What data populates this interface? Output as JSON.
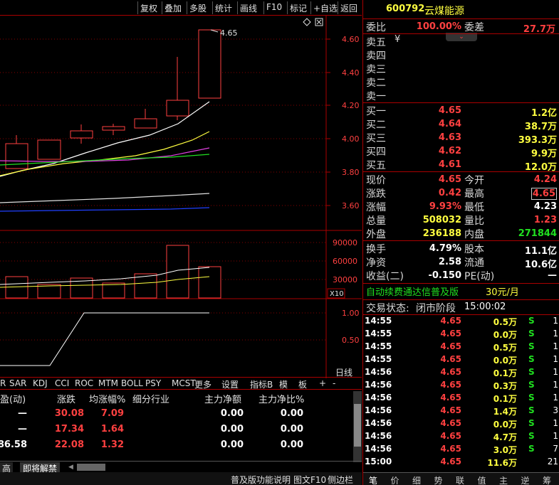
{
  "menu": [
    "复权",
    "叠加",
    "多股",
    "统计",
    "画线",
    "F10",
    "标记",
    "+自选",
    "返回"
  ],
  "stock": {
    "code": "600792",
    "name": "云煤能源"
  },
  "chart": {
    "price_ticks": [
      "4.60",
      "4.40",
      "4.20",
      "4.00",
      "3.80",
      "3.60"
    ],
    "last_label": "4.65",
    "vol_ticks": [
      "90000",
      "60000",
      "30000"
    ],
    "vol_unit": "X10",
    "ind_ticks": [
      "1.00",
      "0.50"
    ],
    "period": "日线"
  },
  "indicators": [
    "R",
    "SAR",
    "KDJ",
    "CCI",
    "ROC",
    "MTM",
    "BOLL",
    "PSY",
    "MCST",
    "更多",
    "设置",
    "指标B",
    "模",
    "板",
    "+",
    "-"
  ],
  "table": {
    "headers": [
      "盈(动)",
      "涨跌",
      "均涨幅%",
      "细分行业",
      "主力净额",
      "主力净比%"
    ],
    "rows": [
      [
        "—",
        "30.08",
        "7.09",
        "",
        "0.00",
        "0.00"
      ],
      [
        "—",
        "17.34",
        "1.64",
        "",
        "0.00",
        "0.00"
      ],
      [
        "86.58",
        "22.08",
        "1.32",
        "",
        "0.00",
        "0.00"
      ]
    ]
  },
  "bottom_tabs": [
    "高",
    "即将解禁"
  ],
  "bottom_bar": [
    "普及版功能说明",
    "图文F10",
    "侧边栏"
  ],
  "quote": {
    "wb_label": "委比",
    "wb": "100.00%",
    "wc_label": "委差",
    "wc": "27.7万",
    "sell": [
      [
        "卖五",
        ""
      ],
      [
        "卖四",
        ""
      ],
      [
        "卖三",
        ""
      ],
      [
        "卖二",
        ""
      ],
      [
        "卖一",
        ""
      ]
    ],
    "buy": [
      [
        "买一",
        "4.65",
        "1.2亿"
      ],
      [
        "买二",
        "4.64",
        "38.7万"
      ],
      [
        "买三",
        "4.63",
        "393.3万"
      ],
      [
        "买四",
        "4.62",
        "9.9万"
      ],
      [
        "买五",
        "4.61",
        "12.0万"
      ]
    ],
    "stats": [
      [
        "现价",
        "4.65",
        "今开",
        "4.24"
      ],
      [
        "涨跌",
        "0.42",
        "最高",
        "4.65"
      ],
      [
        "涨幅",
        "9.93%",
        "最低",
        "4.23"
      ],
      [
        "总量",
        "508032",
        "量比",
        "1.23"
      ],
      [
        "外盘",
        "236188",
        "内盘",
        "271844"
      ]
    ],
    "stats2": [
      [
        "换手",
        "4.79%",
        "股本",
        "11.1亿"
      ],
      [
        "净资",
        "2.58",
        "流通",
        "10.6亿"
      ],
      [
        "收益(二)",
        "-0.150",
        "PE(动)",
        "—"
      ]
    ],
    "ad": "自动续费通达信普及版",
    "ad_price": "30元/月",
    "status_label": "交易状态:",
    "status": "闭市阶段",
    "status_time": "15:00:02"
  },
  "ticks": [
    [
      "14:55",
      "4.65",
      "0.5万",
      "S",
      "1"
    ],
    [
      "14:55",
      "4.65",
      "0.0万",
      "S",
      "1"
    ],
    [
      "14:55",
      "4.65",
      "0.5万",
      "S",
      "1"
    ],
    [
      "14:55",
      "4.65",
      "0.0万",
      "S",
      "1"
    ],
    [
      "14:56",
      "4.65",
      "0.1万",
      "S",
      "1"
    ],
    [
      "14:56",
      "4.65",
      "0.3万",
      "S",
      "1"
    ],
    [
      "14:56",
      "4.65",
      "0.1万",
      "S",
      "1"
    ],
    [
      "14:56",
      "4.65",
      "1.4万",
      "S",
      "3"
    ],
    [
      "14:56",
      "4.65",
      "0.0万",
      "S",
      "1"
    ],
    [
      "14:56",
      "4.65",
      "4.7万",
      "S",
      "1"
    ],
    [
      "14:56",
      "4.65",
      "3.0万",
      "S",
      "7"
    ],
    [
      "15:00",
      "4.65",
      "11.6万",
      "",
      "21"
    ]
  ],
  "side_tabs": [
    "笔",
    "价",
    "细",
    "势",
    "联",
    "值",
    "主",
    "逆",
    "筹"
  ]
}
